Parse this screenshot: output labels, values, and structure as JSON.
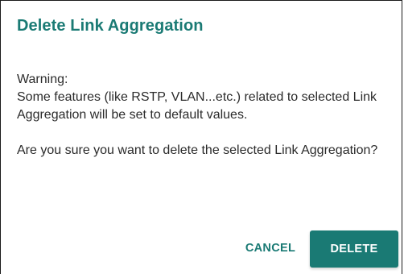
{
  "dialog": {
    "title": "Delete Link Aggregation",
    "warning_label": "Warning:",
    "warning_message": "Some features (like RSTP, VLAN...etc.) related to selected Link Aggregation will be set to default values.",
    "confirm_message": "Are you sure you want to delete the selected Link Aggregation?",
    "cancel_label": "CANCEL",
    "delete_label": "DELETE"
  },
  "colors": {
    "accent": "#1a7a74",
    "text": "#2b2b2b",
    "background": "#ffffff"
  }
}
